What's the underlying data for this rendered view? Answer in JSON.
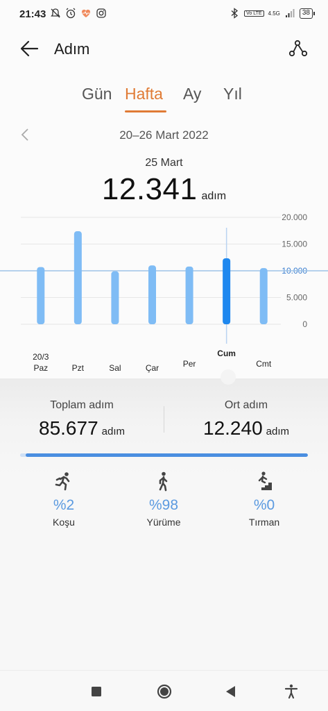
{
  "status_bar": {
    "time": "21:43",
    "network": "4.5G",
    "volte": "Vo LTE",
    "battery": "38"
  },
  "header": {
    "title": "Adım",
    "back_icon": "arrow-left-icon",
    "share_icon": "share-nodes-icon"
  },
  "tabs": [
    {
      "label": "Gün",
      "active": false
    },
    {
      "label": "Hafta",
      "active": true
    },
    {
      "label": "Ay",
      "active": false
    },
    {
      "label": "Yıl",
      "active": false
    }
  ],
  "period": {
    "range": "20–26 Mart 2022",
    "selected_date": "25 Mart",
    "selected_value": "12.341",
    "unit": "adım"
  },
  "chart_data": {
    "type": "bar",
    "categories": [
      "Paz",
      "Pzt",
      "Sal",
      "Çar",
      "Per",
      "Cum",
      "Cmt"
    ],
    "first_category_date": "20/3",
    "values": [
      10700,
      17400,
      9900,
      11000,
      10800,
      12341,
      10500
    ],
    "selected_index": 5,
    "ylim": [
      0,
      20000
    ],
    "y_ticks": [
      "20.000",
      "15.000",
      "10.000",
      "5.000",
      "0"
    ],
    "reference_line": 10000,
    "reference_label": "10.000",
    "colors": {
      "bar": "#7fbcf5",
      "selected": "#1e88ef",
      "reference": "#9ec3e8",
      "grid": "#e6e6e6"
    }
  },
  "summary": {
    "total_label": "Toplam adım",
    "total_value": "85.677",
    "total_unit": "adım",
    "avg_label": "Ort adım",
    "avg_value": "12.240",
    "avg_unit": "adım"
  },
  "activity_breakdown": {
    "fill_fraction": 0.98,
    "items": [
      {
        "label": "Koşu",
        "percent": "%2",
        "icon": "running-icon"
      },
      {
        "label": "Yürüme",
        "percent": "%98",
        "icon": "walking-icon"
      },
      {
        "label": "Tırman",
        "percent": "%0",
        "icon": "climbing-stairs-icon"
      }
    ]
  },
  "nav": {
    "recent": "square-icon",
    "home": "circle-icon",
    "back": "triangle-back-icon",
    "accessibility": "accessibility-icon"
  }
}
